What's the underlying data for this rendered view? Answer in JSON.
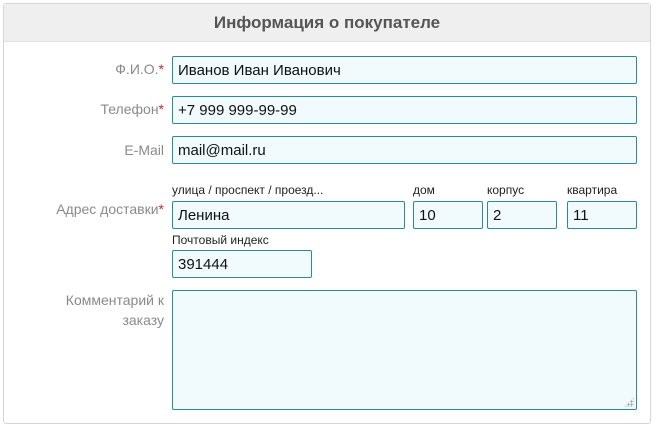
{
  "header": {
    "title": "Информация о покупателе"
  },
  "form": {
    "fio": {
      "label": "Ф.И.О.",
      "required_mark": "*",
      "value": "Иванов Иван Иванович"
    },
    "phone": {
      "label": "Телефон",
      "required_mark": "*",
      "value": "+7 999 999-99-99"
    },
    "email": {
      "label": "E-Mail",
      "value": "mail@mail.ru"
    },
    "address": {
      "label": "Адрес доставки",
      "required_mark": "*",
      "street_label": "улица / проспект / проезд...",
      "street_value": "Ленина",
      "house_label": "дом",
      "house_value": "10",
      "building_label": "корпус",
      "building_value": "2",
      "apartment_label": "квартира",
      "apartment_value": "11",
      "postcode_label": "Почтовый индекс",
      "postcode_value": "391444"
    },
    "comment": {
      "label_line1": "Комментарий к",
      "label_line2": "заказу",
      "value": ""
    }
  },
  "colors": {
    "field_border": "#2a8c95",
    "field_background": "#f1fafc",
    "required_mark": "#c0292e",
    "label_text": "#8a8a8a",
    "header_background": "#efefef"
  }
}
